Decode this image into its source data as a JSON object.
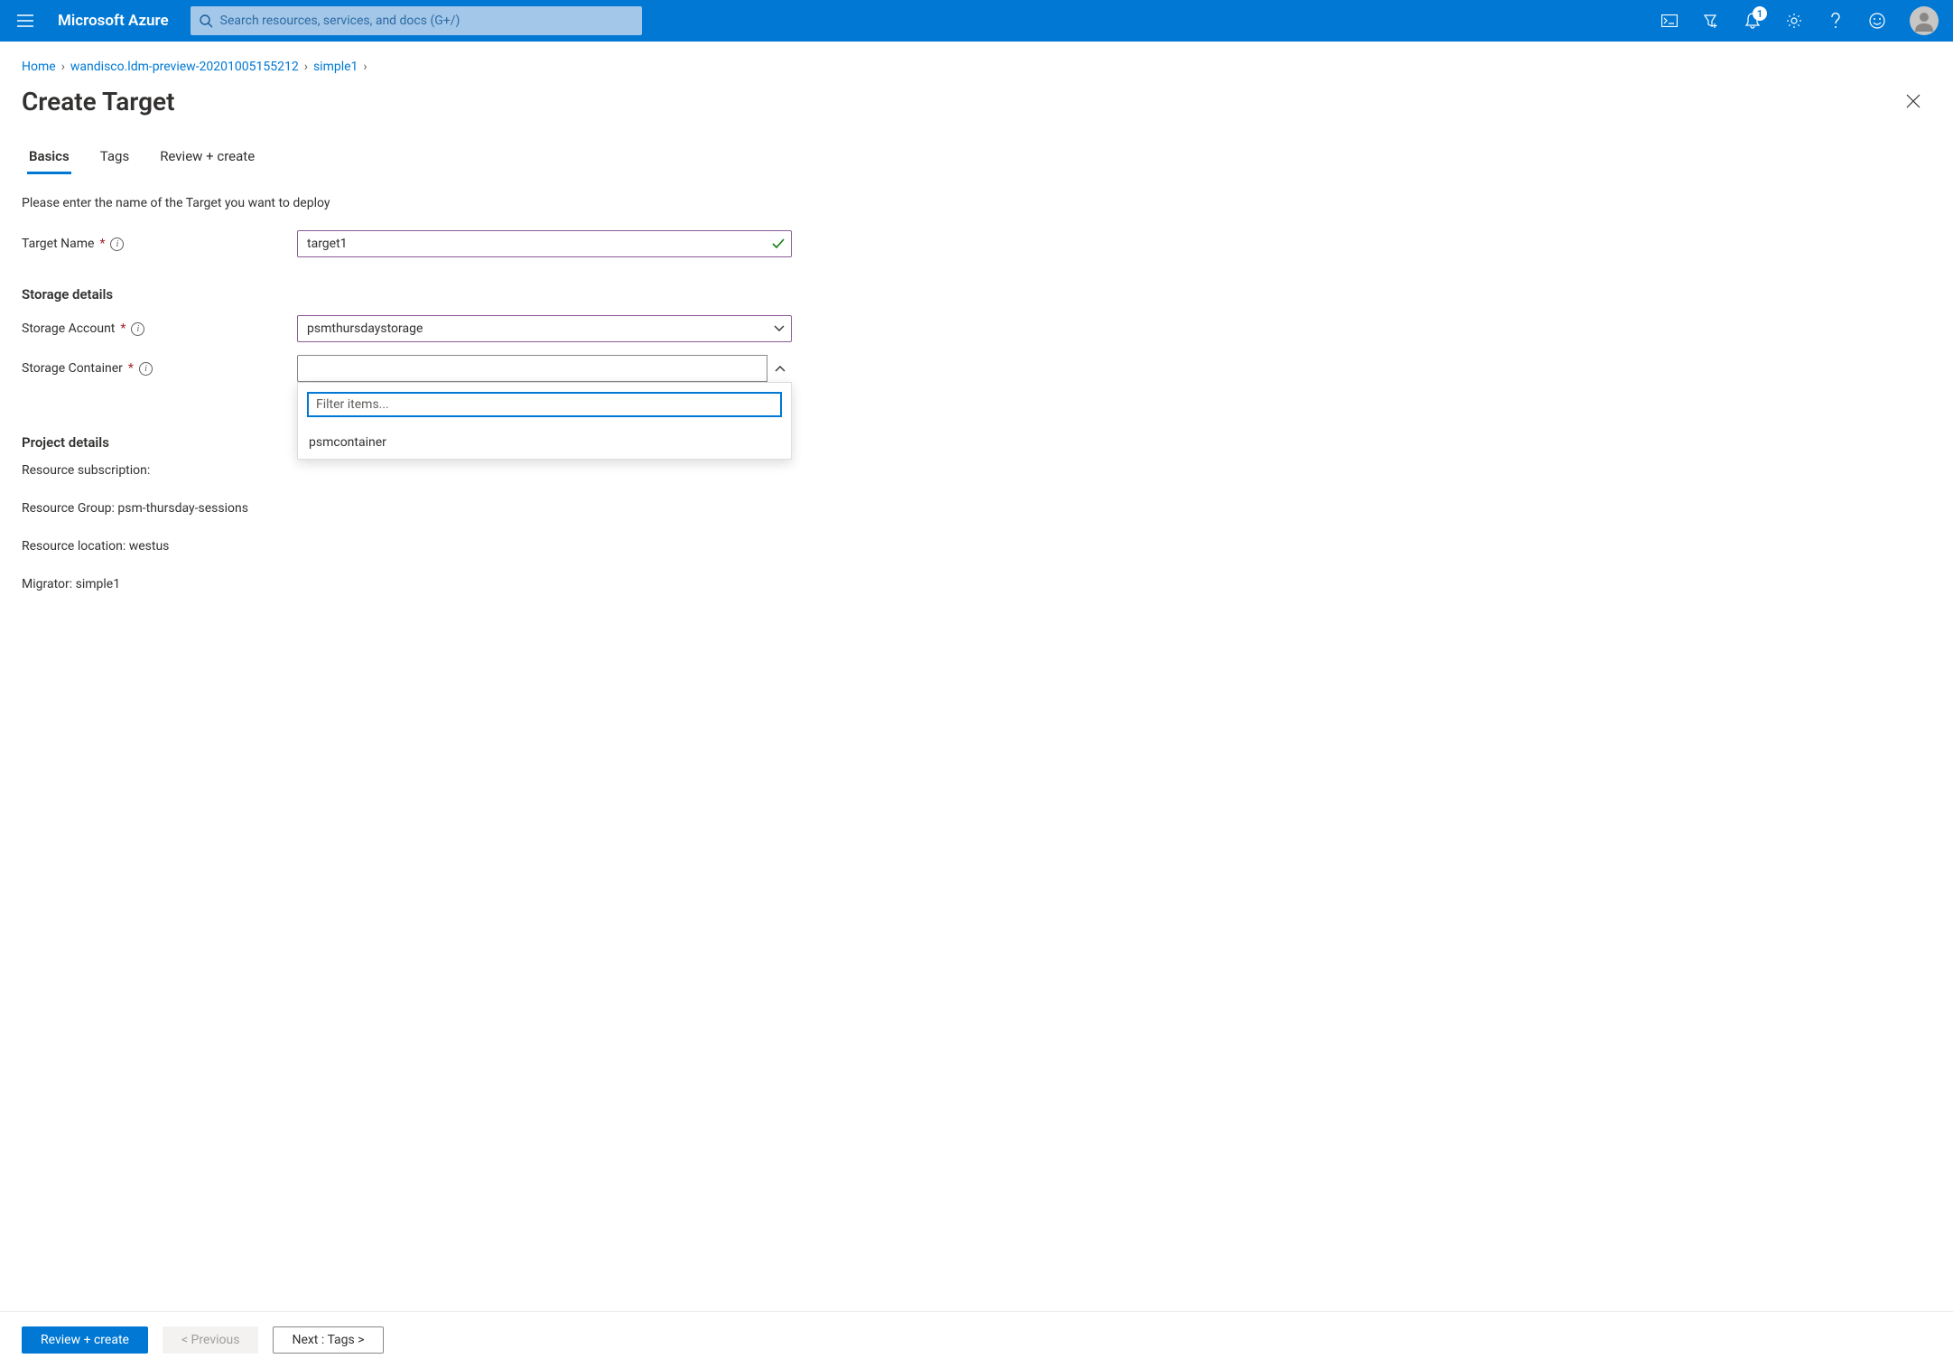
{
  "brand": "Microsoft Azure",
  "search": {
    "placeholder": "Search resources, services, and docs (G+/)"
  },
  "notifications": {
    "count": "1"
  },
  "breadcrumb": {
    "items": [
      "Home",
      "wandisco.ldm-preview-20201005155212",
      "simple1"
    ]
  },
  "page": {
    "title": "Create Target"
  },
  "tabs": [
    {
      "label": "Basics",
      "active": true
    },
    {
      "label": "Tags",
      "active": false
    },
    {
      "label": "Review + create",
      "active": false
    }
  ],
  "form": {
    "intro": "Please enter the name of the Target you want to deploy",
    "target_name_label": "Target Name",
    "target_name_value": "target1",
    "storage_section": "Storage details",
    "storage_account_label": "Storage Account",
    "storage_account_value": "psmthursdaystorage",
    "storage_container_label": "Storage Container",
    "storage_container_value": "",
    "dropdown": {
      "filter_placeholder": "Filter items...",
      "options": [
        "psmcontainer"
      ]
    },
    "project_section": "Project details",
    "resource_subscription_line": "Resource subscription:",
    "resource_group_line": "Resource Group: psm-thursday-sessions",
    "resource_location_line": "Resource location: westus",
    "migrator_line": "Migrator: simple1"
  },
  "footer": {
    "review_create": "Review + create",
    "previous": "< Previous",
    "next": "Next : Tags >"
  }
}
